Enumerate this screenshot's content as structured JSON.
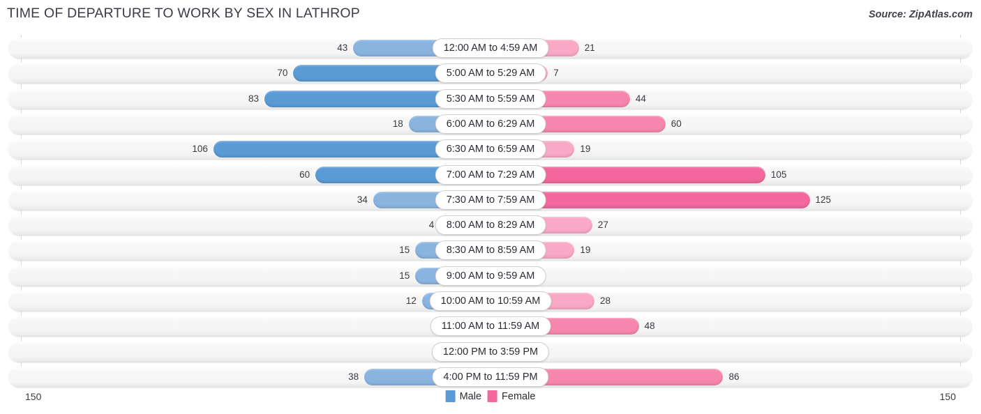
{
  "header": {
    "title": "TIME OF DEPARTURE TO WORK BY SEX IN LATHROP",
    "source": "Source: ZipAtlas.com"
  },
  "legend": {
    "male_label": "Male",
    "female_label": "Female",
    "male_color": "#5b9bd5",
    "female_color": "#f2689c"
  },
  "axis": {
    "left_max": "150",
    "right_max": "150"
  },
  "chart_data": {
    "type": "bar",
    "orientation": "horizontal-diverging",
    "title": "TIME OF DEPARTURE TO WORK BY SEX IN LATHROP",
    "xlabel": "",
    "ylabel": "",
    "xlim": [
      0,
      150
    ],
    "grid": false,
    "legend_position": "bottom-center",
    "categories": [
      "12:00 AM to 4:59 AM",
      "5:00 AM to 5:29 AM",
      "5:30 AM to 5:59 AM",
      "6:00 AM to 6:29 AM",
      "6:30 AM to 6:59 AM",
      "7:00 AM to 7:29 AM",
      "7:30 AM to 7:59 AM",
      "8:00 AM to 8:29 AM",
      "8:30 AM to 8:59 AM",
      "9:00 AM to 9:59 AM",
      "10:00 AM to 10:59 AM",
      "11:00 AM to 11:59 AM",
      "12:00 PM to 3:59 PM",
      "4:00 PM to 11:59 PM"
    ],
    "series": [
      {
        "name": "Male",
        "values": [
          43,
          70,
          83,
          18,
          106,
          60,
          34,
          4,
          15,
          15,
          12,
          0,
          1,
          38
        ]
      },
      {
        "name": "Female",
        "values": [
          21,
          7,
          44,
          60,
          19,
          105,
          125,
          27,
          19,
          0,
          28,
          48,
          0,
          86
        ]
      }
    ]
  },
  "rows": [
    {
      "label": "12:00 AM to 4:59 AM",
      "male": "43",
      "female": "21"
    },
    {
      "label": "5:00 AM to 5:29 AM",
      "male": "70",
      "female": "7"
    },
    {
      "label": "5:30 AM to 5:59 AM",
      "male": "83",
      "female": "44"
    },
    {
      "label": "6:00 AM to 6:29 AM",
      "male": "18",
      "female": "60"
    },
    {
      "label": "6:30 AM to 6:59 AM",
      "male": "106",
      "female": "19"
    },
    {
      "label": "7:00 AM to 7:29 AM",
      "male": "60",
      "female": "105"
    },
    {
      "label": "7:30 AM to 7:59 AM",
      "male": "34",
      "female": "125"
    },
    {
      "label": "8:00 AM to 8:29 AM",
      "male": "4",
      "female": "27"
    },
    {
      "label": "8:30 AM to 8:59 AM",
      "male": "15",
      "female": "19"
    },
    {
      "label": "9:00 AM to 9:59 AM",
      "male": "15",
      "female": "0"
    },
    {
      "label": "10:00 AM to 10:59 AM",
      "male": "12",
      "female": "28"
    },
    {
      "label": "11:00 AM to 11:59 AM",
      "male": "0",
      "female": "48"
    },
    {
      "label": "12:00 PM to 3:59 PM",
      "male": "1",
      "female": "0"
    },
    {
      "label": "4:00 PM to 11:59 PM",
      "male": "38",
      "female": "86"
    }
  ]
}
